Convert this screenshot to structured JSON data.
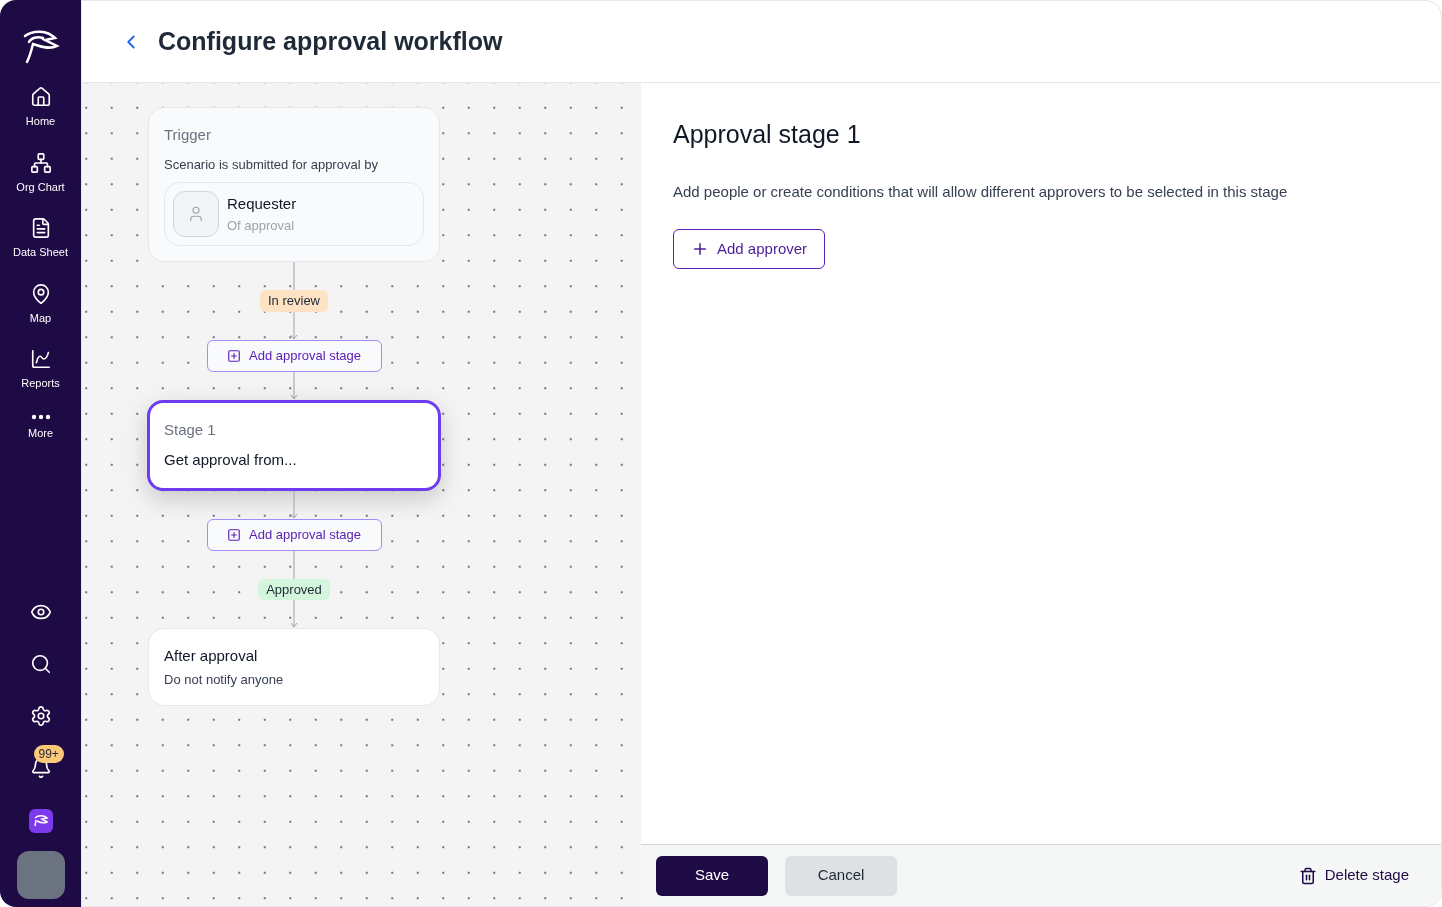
{
  "header": {
    "title": "Configure approval workflow"
  },
  "sidebar": {
    "items": [
      {
        "label": "Home"
      },
      {
        "label": "Org Chart"
      },
      {
        "label": "Data Sheet"
      },
      {
        "label": "Map"
      },
      {
        "label": "Reports"
      },
      {
        "label": "More"
      }
    ],
    "notification_badge": "99+"
  },
  "flow": [
    {
      "kind": "trigger",
      "title": "Trigger",
      "text": "Scenario is submitted for approval by",
      "person": {
        "name": "Requester",
        "sub": "Of approval"
      }
    },
    {
      "kind": "status",
      "label": "In review",
      "color": "#fde3c4"
    },
    {
      "kind": "add",
      "label": "Add approval stage"
    },
    {
      "kind": "stage",
      "title": "Stage 1",
      "text": "Get approval from...",
      "selected": true
    },
    {
      "kind": "add",
      "label": "Add approval stage"
    },
    {
      "kind": "status",
      "label": "Approved",
      "color": "#d3f6dc"
    },
    {
      "kind": "end",
      "title": "After approval",
      "text": "Do not notify anyone"
    }
  ],
  "panel": {
    "title": "Approval stage 1",
    "description": "Add people or create conditions that will allow different approvers to be selected in this stage",
    "add_button": "Add approver"
  },
  "footer": {
    "save": "Save",
    "cancel": "Cancel",
    "delete": "Delete stage"
  }
}
